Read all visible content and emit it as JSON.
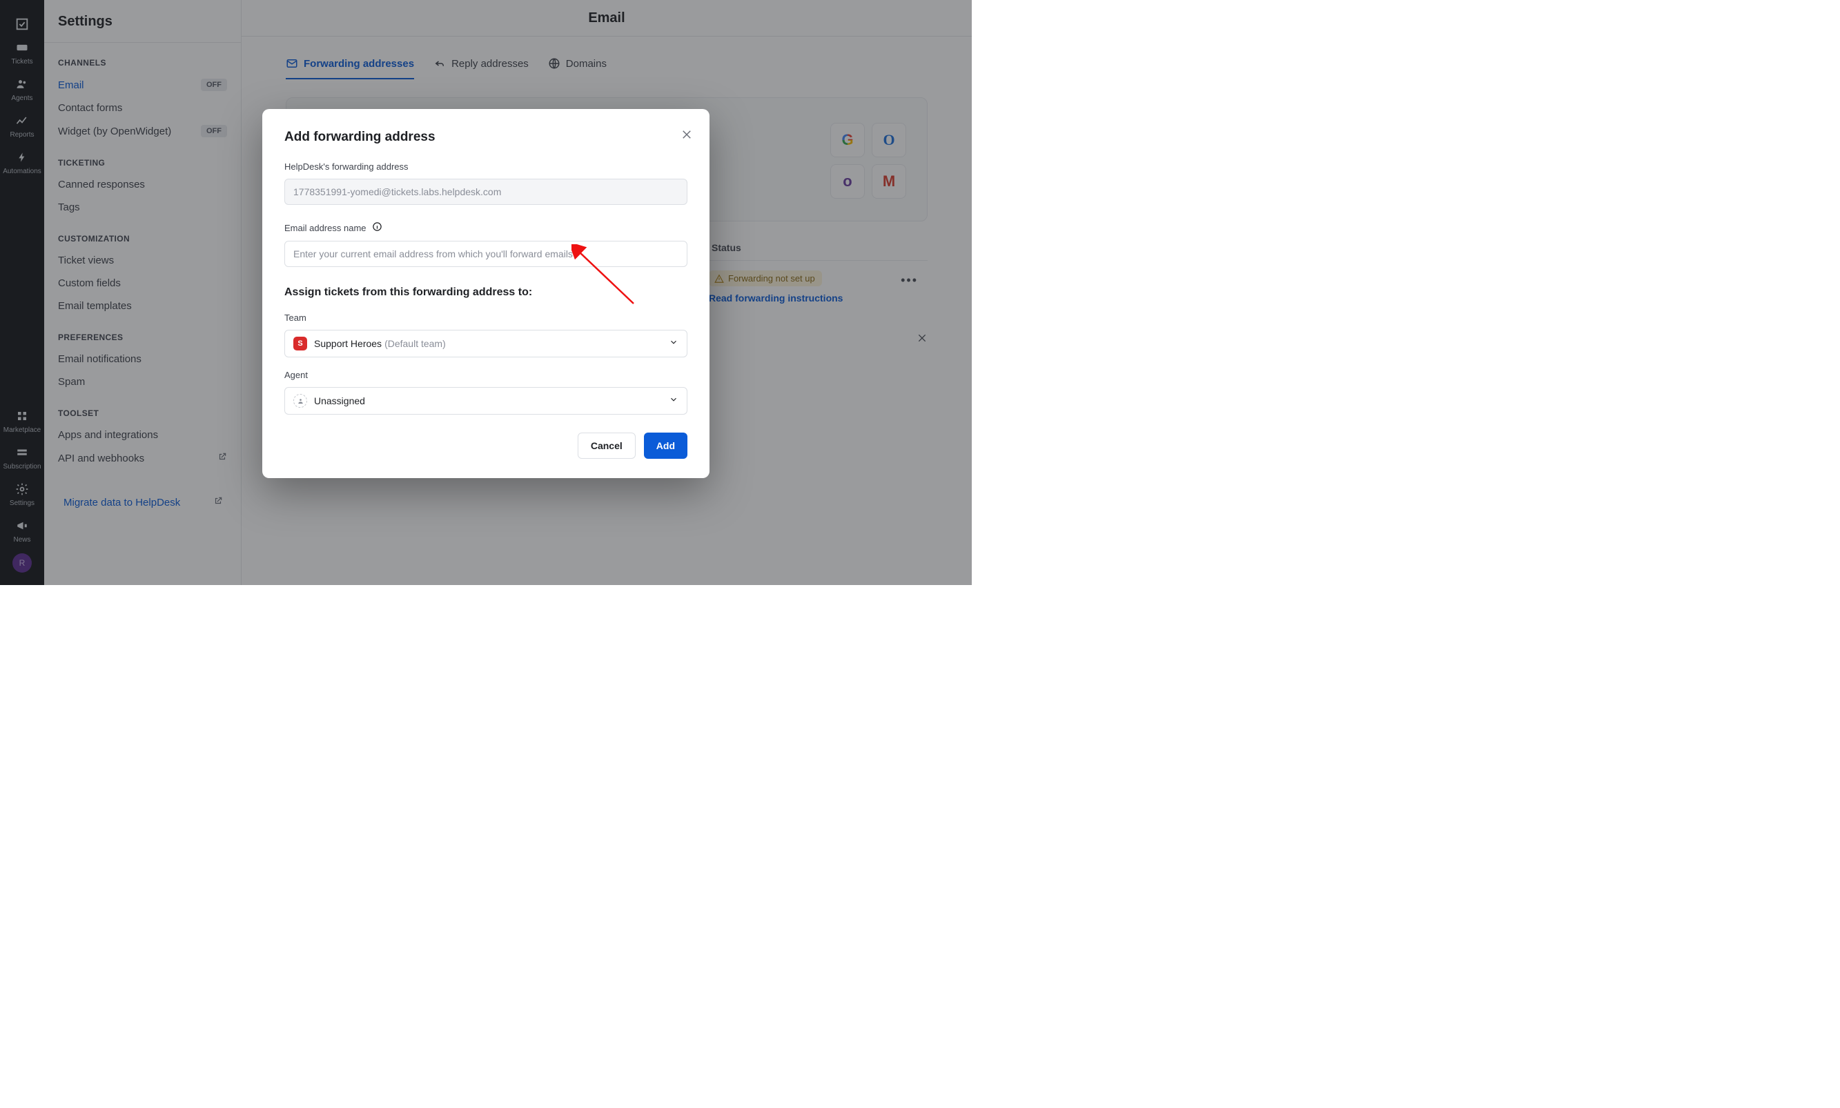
{
  "rail": {
    "items": [
      {
        "label": ""
      },
      {
        "label": "Tickets"
      },
      {
        "label": "Agents"
      },
      {
        "label": "Reports"
      },
      {
        "label": "Automations"
      }
    ],
    "bottom": [
      {
        "label": "Marketplace"
      },
      {
        "label": "Subscription"
      },
      {
        "label": "Settings"
      },
      {
        "label": "News"
      }
    ],
    "avatar_initial": "R"
  },
  "sidebar": {
    "title": "Settings",
    "sections": {
      "channels": {
        "heading": "CHANNELS",
        "items": [
          {
            "label": "Email",
            "badge": "OFF",
            "active": true
          },
          {
            "label": "Contact forms"
          },
          {
            "label": "Widget (by OpenWidget)",
            "badge": "OFF"
          }
        ]
      },
      "ticketing": {
        "heading": "TICKETING",
        "items": [
          {
            "label": "Canned responses"
          },
          {
            "label": "Tags"
          }
        ]
      },
      "customization": {
        "heading": "CUSTOMIZATION",
        "items": [
          {
            "label": "Ticket views"
          },
          {
            "label": "Custom fields"
          },
          {
            "label": "Email templates"
          }
        ]
      },
      "preferences": {
        "heading": "PREFERENCES",
        "items": [
          {
            "label": "Email notifications"
          },
          {
            "label": "Spam"
          }
        ]
      },
      "toolset": {
        "heading": "TOOLSET",
        "items": [
          {
            "label": "Apps and integrations"
          },
          {
            "label": "API and webhooks",
            "external": true
          }
        ]
      }
    },
    "migrate": "Migrate data to HelpDesk"
  },
  "page": {
    "title": "Email",
    "tabs": [
      {
        "label": "Forwarding addresses",
        "active": true
      },
      {
        "label": "Reply addresses"
      },
      {
        "label": "Domains"
      }
    ],
    "promo_icons": [
      "G",
      "O",
      "o",
      "M"
    ],
    "table": {
      "col_status": "Status",
      "row1_status": "Forwarding not set up",
      "row1_link": "Read forwarding instructions"
    },
    "reply_link": "eply addresses"
  },
  "modal": {
    "title": "Add forwarding address",
    "fwd_label": "HelpDesk's forwarding address",
    "fwd_value": "1778351991-yomedi@tickets.labs.helpdesk.com",
    "name_label": "Email address name",
    "name_placeholder": "Enter your current email address from which you'll forward emails",
    "assign_heading": "Assign tickets from this forwarding address to:",
    "team_label": "Team",
    "team_badge": "S",
    "team_name": "Support Heroes",
    "team_extra": "(Default team)",
    "agent_label": "Agent",
    "agent_name": "Unassigned",
    "cancel": "Cancel",
    "add": "Add"
  }
}
